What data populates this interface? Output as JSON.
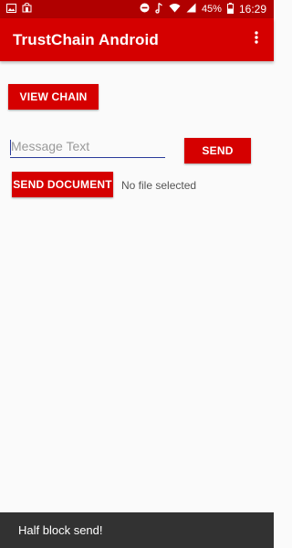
{
  "status_bar": {
    "battery": "45%",
    "time": "16:29"
  },
  "app_bar": {
    "title": "TrustChain Android"
  },
  "main": {
    "view_chain_label": "VIEW CHAIN",
    "message_placeholder": "Message Text",
    "message_value": "",
    "send_label": "SEND",
    "send_document_label": "SEND DOCUMENT",
    "file_status": "No file selected"
  },
  "snackbar": {
    "message": "Half block send!"
  },
  "colors": {
    "primary": "#d50000",
    "primary_dark": "#b00000",
    "input_underline": "#2a3b9b",
    "snackbar": "#323232"
  }
}
